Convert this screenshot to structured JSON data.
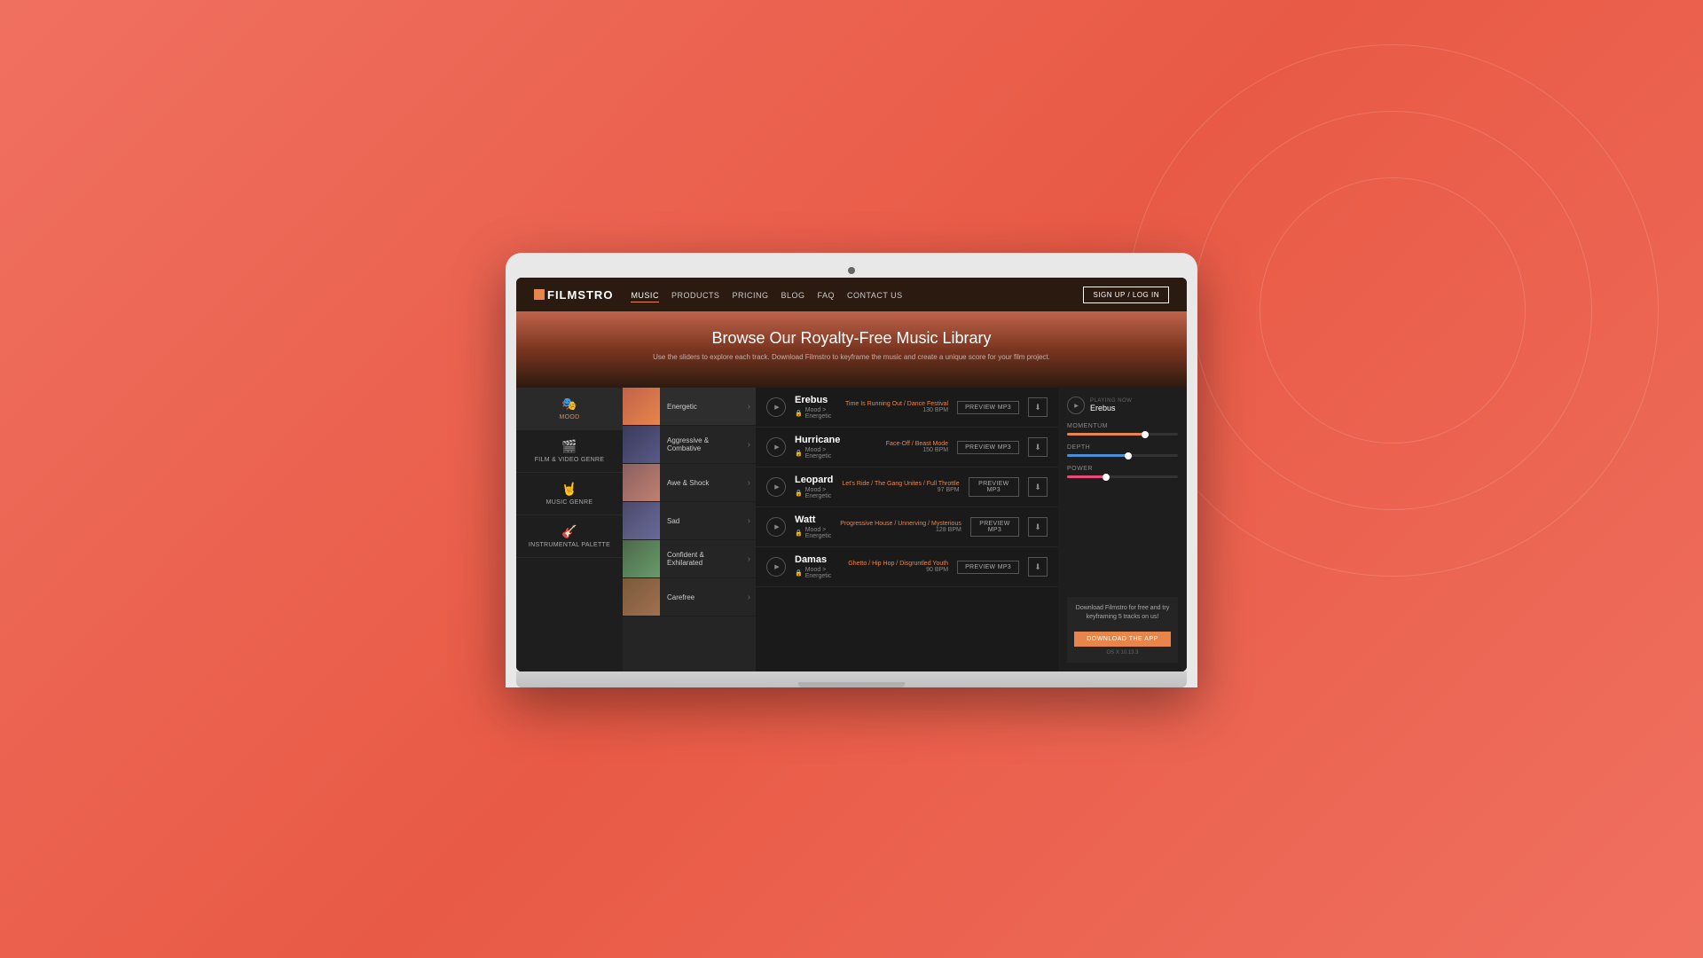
{
  "background": {
    "color": "#e85a45"
  },
  "nav": {
    "logo": "FILMSTRO",
    "links": [
      {
        "label": "MUSIC",
        "active": true
      },
      {
        "label": "PRODUCTS",
        "active": false
      },
      {
        "label": "PRICING",
        "active": false
      },
      {
        "label": "BLOG",
        "active": false
      },
      {
        "label": "FAQ",
        "active": false
      },
      {
        "label": "CONTACT US",
        "active": false
      }
    ],
    "cta": "SIGN UP / LOG IN"
  },
  "hero": {
    "title": "Browse Our Royalty-Free Music Library",
    "subtitle": "Use the sliders to explore each track. Download Filmstro to keyframe the music and create a unique score for your film project."
  },
  "sidebar": {
    "items": [
      {
        "label": "Mood",
        "active": true,
        "icon": "🎭"
      },
      {
        "label": "Film & Video Genre",
        "active": false,
        "icon": "🎬"
      },
      {
        "label": "Music Genre",
        "active": false,
        "icon": "🤘"
      },
      {
        "label": "Instrumental Palette",
        "active": false,
        "icon": "🎸"
      }
    ]
  },
  "categories": [
    {
      "name": "Energetic",
      "active": true,
      "thumb": "energetic"
    },
    {
      "name": "Aggressive & Combative",
      "active": false,
      "thumb": "aggressive"
    },
    {
      "name": "Awe & Shock",
      "active": false,
      "thumb": "awe"
    },
    {
      "name": "Sad",
      "active": false,
      "thumb": "sad"
    },
    {
      "name": "Confident & Exhilarated",
      "active": false,
      "thumb": "confident"
    },
    {
      "name": "Carefree",
      "active": false,
      "thumb": "carefree"
    }
  ],
  "tracks": [
    {
      "name": "Erebus",
      "mood": "Mood > Energetic",
      "tags": "Time Is Running Out / Dance Festival",
      "bpm": "130",
      "bpm_label": "BPM"
    },
    {
      "name": "Hurricane",
      "mood": "Mood > Energetic",
      "tags": "Face-Off / Beast Mode",
      "bpm": "150",
      "bpm_label": "BPM"
    },
    {
      "name": "Leopard",
      "mood": "Mood > Energetic",
      "tags": "Let's Ride / The Gang Unites / Full Throttle",
      "bpm": "97",
      "bpm_label": "BPM"
    },
    {
      "name": "Watt",
      "mood": "Mood > Energetic",
      "tags": "Progressive House / Unnerving / Mysterious",
      "bpm": "128",
      "bpm_label": "BPM"
    },
    {
      "name": "Damas",
      "mood": "Mood > Energetic",
      "tags": "Ghetto / Hip Hop / Disgruntled Youth",
      "bpm": "90",
      "bpm_label": "BPM"
    }
  ],
  "right_panel": {
    "playing_now_label": "PLAYING NOW",
    "playing_now_track": "Erebus",
    "momentum_label": "MOMENTUM",
    "momentum_value": 70,
    "depth_label": "DEPTH",
    "depth_value": 55,
    "power_label": "POWER",
    "power_value": 35,
    "download_text": "Download Filmstro for free and try keyframing 5 tracks on us!",
    "download_btn": "DOWNLOAD THE APP",
    "os_version": "OS X 10.13.3"
  }
}
